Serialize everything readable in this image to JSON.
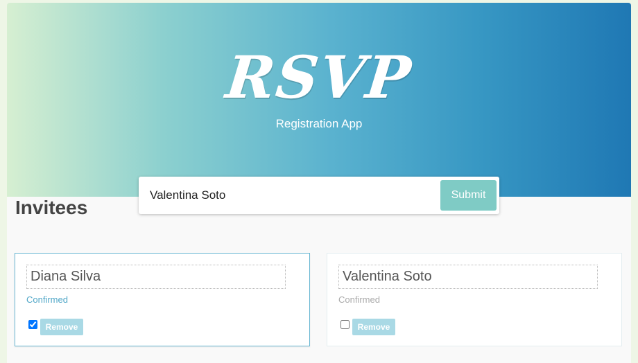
{
  "header": {
    "logo_text": "RSVP",
    "subtitle": "Registration App"
  },
  "registrar": {
    "input_value": "Valentina Soto",
    "submit_label": "Submit"
  },
  "main": {
    "title": "Invitees",
    "invitees": [
      {
        "name": "Diana Silva",
        "status": "Confirmed",
        "confirmed": true,
        "remove_label": "Remove"
      },
      {
        "name": "Valentina Soto",
        "status": "Confirmed",
        "confirmed": false,
        "remove_label": "Remove"
      }
    ]
  },
  "colors": {
    "accent": "#4fa6c7",
    "submit_button": "#7fcbc5",
    "remove_button": "#a9d9e5",
    "gradient_start": "#d6efd1",
    "gradient_end": "#1f78b4"
  }
}
